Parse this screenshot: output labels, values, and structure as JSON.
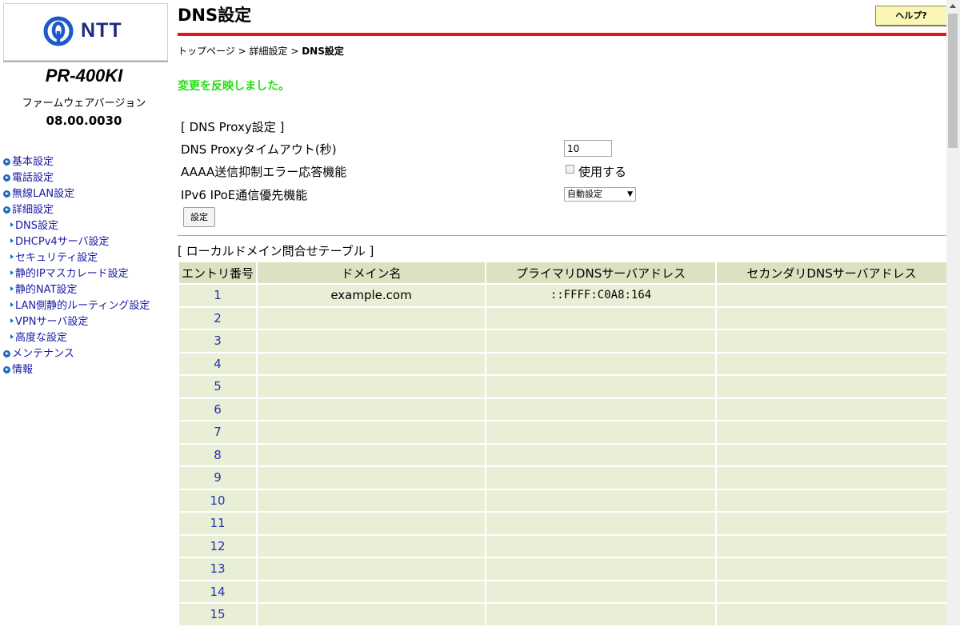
{
  "sidebar": {
    "logo_text": "NTT",
    "model": "PR-400KI",
    "firmware_label": "ファームウェアバージョン",
    "firmware_version": "08.00.0030",
    "nav": [
      {
        "label": "基本設定",
        "level": 0
      },
      {
        "label": "電話設定",
        "level": 0
      },
      {
        "label": "無線LAN設定",
        "level": 0
      },
      {
        "label": "詳細設定",
        "level": 0
      },
      {
        "label": "DNS設定",
        "level": 1
      },
      {
        "label": "DHCPv4サーバ設定",
        "level": 1
      },
      {
        "label": "セキュリティ設定",
        "level": 1
      },
      {
        "label": "静的IPマスカレード設定",
        "level": 1
      },
      {
        "label": "静的NAT設定",
        "level": 1
      },
      {
        "label": "LAN側静的ルーティング設定",
        "level": 1
      },
      {
        "label": "VPNサーバ設定",
        "level": 1
      },
      {
        "label": "高度な設定",
        "level": 1
      },
      {
        "label": "メンテナンス",
        "level": 0
      },
      {
        "label": "情報",
        "level": 0
      }
    ]
  },
  "header": {
    "title": "DNS設定",
    "help_label": "ヘルプ?",
    "breadcrumb": [
      "トップページ",
      "詳細設定",
      "DNS設定"
    ]
  },
  "status_message": "変更を反映しました。",
  "dns_proxy": {
    "section_title": "[ DNS Proxy設定 ]",
    "timeout_label": "DNS Proxyタイムアウト(秒)",
    "timeout_value": "10",
    "aaaa_label": "AAAA送信抑制エラー応答機能",
    "aaaa_checkbox_label": "使用する",
    "aaaa_checked": false,
    "ipv6_label": "IPv6 IPoE通信優先機能",
    "ipv6_selected": "自動設定",
    "set_button": "設定"
  },
  "local_domain": {
    "section_title": "[ ローカルドメイン問合せテーブル ]",
    "columns": [
      "エントリ番号",
      "ドメイン名",
      "プライマリDNSサーバアドレス",
      "セカンダリDNSサーバアドレス"
    ],
    "rows": [
      {
        "entry": "1",
        "domain": "example.com",
        "primary": "::FFFF:C0A8:164",
        "secondary": ""
      },
      {
        "entry": "2",
        "domain": "",
        "primary": "",
        "secondary": ""
      },
      {
        "entry": "3",
        "domain": "",
        "primary": "",
        "secondary": ""
      },
      {
        "entry": "4",
        "domain": "",
        "primary": "",
        "secondary": ""
      },
      {
        "entry": "5",
        "domain": "",
        "primary": "",
        "secondary": ""
      },
      {
        "entry": "6",
        "domain": "",
        "primary": "",
        "secondary": ""
      },
      {
        "entry": "7",
        "domain": "",
        "primary": "",
        "secondary": ""
      },
      {
        "entry": "8",
        "domain": "",
        "primary": "",
        "secondary": ""
      },
      {
        "entry": "9",
        "domain": "",
        "primary": "",
        "secondary": ""
      },
      {
        "entry": "10",
        "domain": "",
        "primary": "",
        "secondary": ""
      },
      {
        "entry": "11",
        "domain": "",
        "primary": "",
        "secondary": ""
      },
      {
        "entry": "12",
        "domain": "",
        "primary": "",
        "secondary": ""
      },
      {
        "entry": "13",
        "domain": "",
        "primary": "",
        "secondary": ""
      },
      {
        "entry": "14",
        "domain": "",
        "primary": "",
        "secondary": ""
      },
      {
        "entry": "15",
        "domain": "",
        "primary": "",
        "secondary": ""
      }
    ]
  },
  "colors": {
    "accent_red": "#ee1111",
    "status_green": "#22dd11",
    "link_blue": "#1a1aa6",
    "table_header_bg": "#dde0c1",
    "table_cell_bg": "#e9efd6",
    "help_button_bg": "#fbf6b4",
    "logo_blue": "#1d2a80"
  },
  "icons": {
    "nav_top": "circle-arrow-icon",
    "nav_sub": "triangle-bullet-icon",
    "logo": "ntt-logo-icon"
  }
}
